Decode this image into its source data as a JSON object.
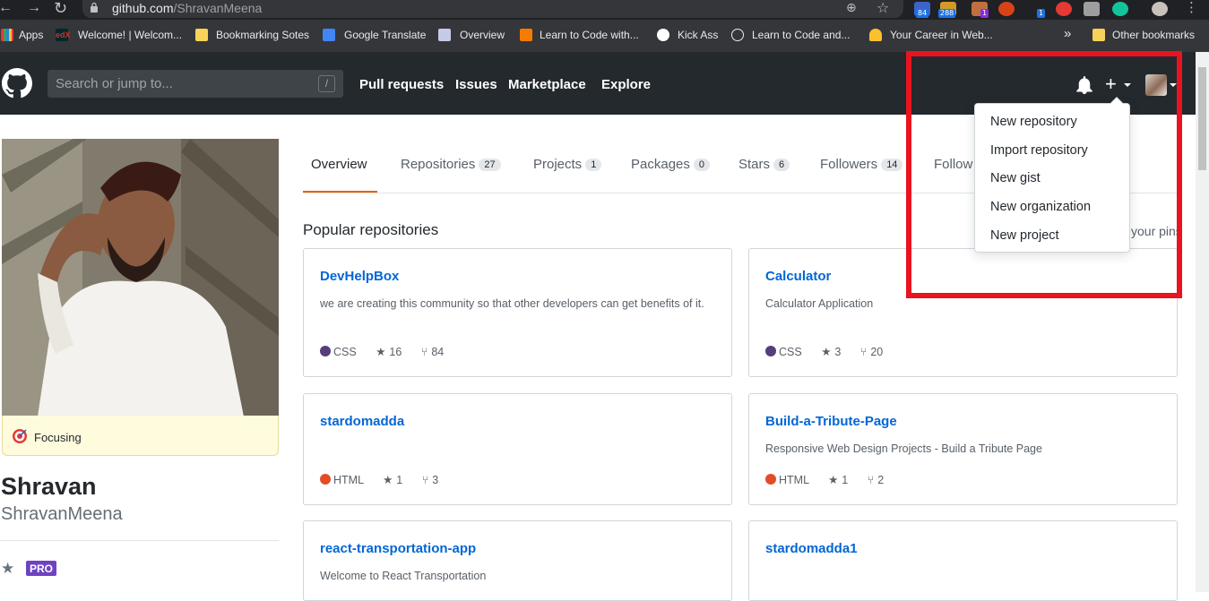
{
  "browser": {
    "url_host": "github.com",
    "url_path": "/ShravanMeena",
    "extension_badges": [
      "84",
      "288",
      "1",
      "1"
    ],
    "bookmarks": [
      {
        "label": "Apps",
        "icon": "apps-grid-icon"
      },
      {
        "label": "Welcome! | Welcom...",
        "icon": "edx-icon"
      },
      {
        "label": "Bookmarking Sotes",
        "icon": "folder-icon"
      },
      {
        "label": "Google Translate",
        "icon": "translate-icon"
      },
      {
        "label": "Overview",
        "icon": "overview-icon"
      },
      {
        "label": "Learn to Code with...",
        "icon": "freecodecamp-icon"
      },
      {
        "label": "Kick Ass",
        "icon": "kickass-icon"
      },
      {
        "label": "Learn to Code and...",
        "icon": "codecademy-icon"
      },
      {
        "label": "Your Career in Web...",
        "icon": "career-icon"
      },
      {
        "label": "»",
        "icon": "more-icon"
      },
      {
        "label": "Other bookmarks",
        "icon": "folder-icon"
      }
    ]
  },
  "header": {
    "search_placeholder": "Search or jump to...",
    "search_shortcut": "/",
    "nav": [
      "Pull requests",
      "Issues",
      "Marketplace",
      "Explore"
    ],
    "plus_symbol": "+"
  },
  "profile": {
    "status": "Focusing",
    "name": "Shravan",
    "login": "ShravanMeena",
    "badge": "PRO"
  },
  "tabs": [
    {
      "label": "Overview",
      "count": ""
    },
    {
      "label": "Repositories",
      "count": "27"
    },
    {
      "label": "Projects",
      "count": "1"
    },
    {
      "label": "Packages",
      "count": "0"
    },
    {
      "label": "Stars",
      "count": "6"
    },
    {
      "label": "Followers",
      "count": "14"
    },
    {
      "label": "Follow",
      "count": ""
    }
  ],
  "popular": {
    "title": "Popular repositories",
    "customize": "your pins"
  },
  "repos": [
    {
      "name": "DevHelpBox",
      "desc": "we are creating this community so that other developers can get benefits of it.",
      "lang": "CSS",
      "lang_color": "#563d7c",
      "stars": "16",
      "forks": "84"
    },
    {
      "name": "Calculator",
      "desc": "Calculator Application",
      "lang": "CSS",
      "lang_color": "#563d7c",
      "stars": "3",
      "forks": "20"
    },
    {
      "name": "stardomadda",
      "desc": "",
      "lang": "HTML",
      "lang_color": "#e34c26",
      "stars": "1",
      "forks": "3"
    },
    {
      "name": "Build-a-Tribute-Page",
      "desc": "Responsive Web Design Projects - Build a Tribute Page",
      "lang": "HTML",
      "lang_color": "#e34c26",
      "stars": "1",
      "forks": "2"
    },
    {
      "name": "react-transportation-app",
      "desc": "Welcome to React Transportation",
      "lang": "",
      "lang_color": "",
      "stars": "",
      "forks": ""
    },
    {
      "name": "stardomadda1",
      "desc": "",
      "lang": "",
      "lang_color": "",
      "stars": "",
      "forks": ""
    }
  ],
  "dropdown": {
    "items": [
      "New repository",
      "Import repository",
      "New gist",
      "New organization",
      "New project"
    ]
  },
  "colors": {
    "header_bg": "#24292e",
    "link": "#0366d6",
    "tab_active": "#e36209",
    "highlight_box": "#e8141f",
    "pro": "#6f42c1"
  }
}
